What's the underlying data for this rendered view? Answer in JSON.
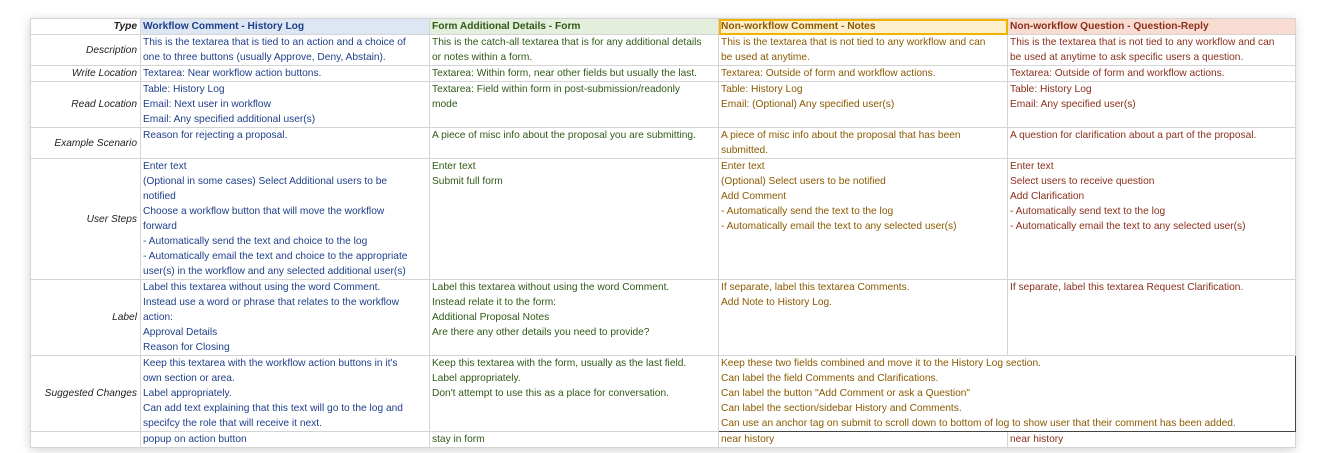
{
  "rows": {
    "type": {
      "label": "Type",
      "c1": [
        "Workflow Comment - History Log"
      ],
      "c2": [
        "Form Additional Details - Form"
      ],
      "c3": [
        "Non-workflow Comment - Notes"
      ],
      "c4": [
        "Non-workflow Question - Question-Reply"
      ]
    },
    "description": {
      "label": "Description",
      "c1": [
        "This is the textarea that is tied to an action and a choice of",
        "one to three buttons (usually Approve, Deny, Abstain)."
      ],
      "c2": [
        "This is the catch-all textarea that is for any additional details",
        "or notes within a form."
      ],
      "c3": [
        "This is the textarea that is not tied to any workflow and can",
        "be used at anytime."
      ],
      "c4": [
        "This is the textarea that is not tied to any workflow and can",
        "be used at anytime to ask specific users a question."
      ]
    },
    "write_location": {
      "label": "Write Location",
      "c1": [
        "Textarea: Near workflow action buttons."
      ],
      "c2": [
        "Textarea: Within form, near other fields but usually the last."
      ],
      "c3": [
        "Textarea: Outside of form and workflow actions."
      ],
      "c4": [
        "Textarea: Outside of form and workflow actions."
      ]
    },
    "read_location": {
      "label": "Read Location",
      "c1": [
        "Table: History Log",
        "Email: Next user in workflow",
        "Email: Any specified additional user(s)"
      ],
      "c2": [
        "Textarea: Field within form in post-submission/readonly",
        "mode"
      ],
      "c3": [
        "Table: History Log",
        "Email: (Optional) Any specified user(s)"
      ],
      "c4": [
        "Table: History Log",
        "Email: Any specified user(s)"
      ]
    },
    "example_scenario": {
      "label": "Example Scenario",
      "c1": [
        "Reason for rejecting a proposal."
      ],
      "c2": [
        "A piece of misc info about the proposal you are submitting."
      ],
      "c3": [
        "A piece of misc info about the proposal that has been",
        "submitted."
      ],
      "c4": [
        "A question for clarification about a part of the proposal."
      ]
    },
    "user_steps": {
      "label": "User Steps",
      "c1": [
        "Enter text",
        "(Optional in some cases) Select Additional users to be",
        "notified",
        "Choose a workflow button that will move the workflow",
        "forward",
        "- Automatically send the text and choice to the log",
        "- Automatically email the text and choice to the appropriate",
        "user(s) in the workflow and any selected additional user(s)"
      ],
      "c2": [
        "Enter text",
        "Submit full form"
      ],
      "c3": [
        "Enter text",
        "(Optional) Select users to be notified",
        "Add Comment",
        "- Automatically send the text to the log",
        "- Automatically email the text to any selected user(s)"
      ],
      "c4": [
        "Enter text",
        "Select users to receive question",
        "Add Clarification",
        "- Automatically send text to the log",
        "- Automatically email the text to any selected user(s)"
      ]
    },
    "label": {
      "label": "Label",
      "c1": [
        "Label this textarea without using the word Comment.",
        "Instead use a word or phrase that relates to the workflow",
        "action:",
        "Approval Details",
        "Reason for Closing"
      ],
      "c2": [
        "Label this textarea without using the word Comment.",
        "Instead relate it to the form:",
        "Additional Proposal Notes",
        "Are there any other details you need to provide?"
      ],
      "c3": [
        "If separate, label this textarea Comments.",
        "Add Note to History Log."
      ],
      "c4": [
        "If separate, label this textarea Request Clarification."
      ]
    },
    "suggested_changes": {
      "label": "Suggested Changes",
      "c1": [
        "Keep this textarea with the workflow action buttons in it's",
        "own section or area.",
        "Label appropriately.",
        "Can add text explaining that this text will go to the log and",
        "specifcy the role that will receive it next."
      ],
      "c2": [
        "Keep this textarea with the form, usually as the last field.",
        "Label appropriately.",
        "Don't attempt to use this as a place for conversation."
      ],
      "c34": [
        "Keep these two fields combined and move it to the History Log section.",
        "Can label the field Comments and Clarifications.",
        "Can label the button \"Add Comment or ask a Question\"",
        "Can label the section/sidebar History and Comments.",
        "Can use an anchor tag on submit to scroll down to bottom of log to show user that their comment has been added."
      ]
    },
    "placement": {
      "label": "",
      "c1": [
        "popup on action button"
      ],
      "c2": [
        "stay in form"
      ],
      "c3": [
        "near history"
      ],
      "c4": [
        "near history"
      ]
    }
  }
}
